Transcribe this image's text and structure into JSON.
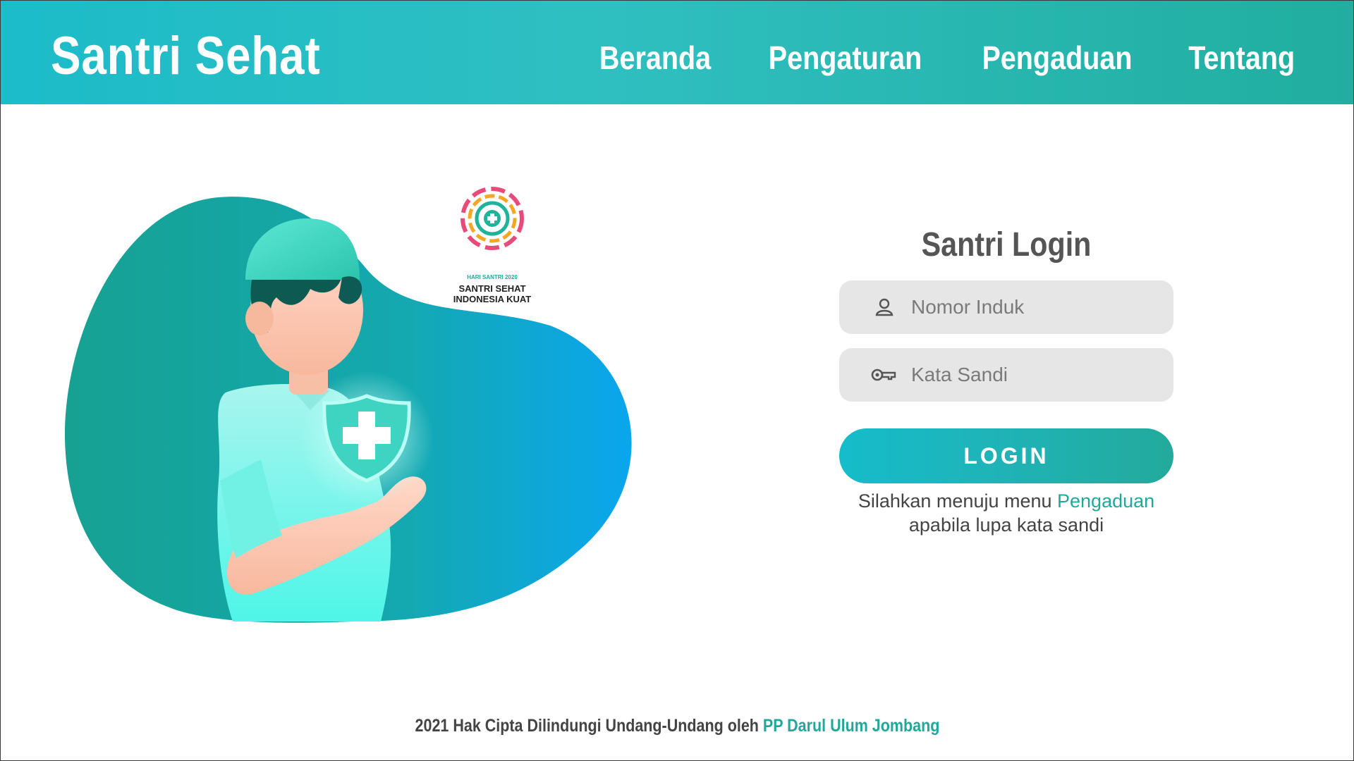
{
  "header": {
    "brand": "Santri Sehat",
    "nav": [
      "Beranda",
      "Pengaturan",
      "Pengaduan",
      "Tentang"
    ]
  },
  "badge": {
    "line1": "HARI SANTRI 2020",
    "line2": "SANTRI SEHAT",
    "line3": "INDONESIA KUAT"
  },
  "login": {
    "title": "Santri Login",
    "username_placeholder": "Nomor Induk",
    "password_placeholder": "Kata Sandi",
    "button_label": "LOGIN",
    "hint_prefix": "Silahkan menuju menu ",
    "hint_link": "Pengaduan",
    "hint_suffix": "apabila lupa kata sandi"
  },
  "footer": {
    "text": "2021 Hak Cipta Dilindungi Undang-Undang oleh ",
    "link": "PP Darul Ulum Jombang"
  },
  "colors": {
    "primary": "#20a99a",
    "header_start": "#1cbcca",
    "header_end": "#21aea0",
    "field_bg": "#e6e6e6"
  }
}
